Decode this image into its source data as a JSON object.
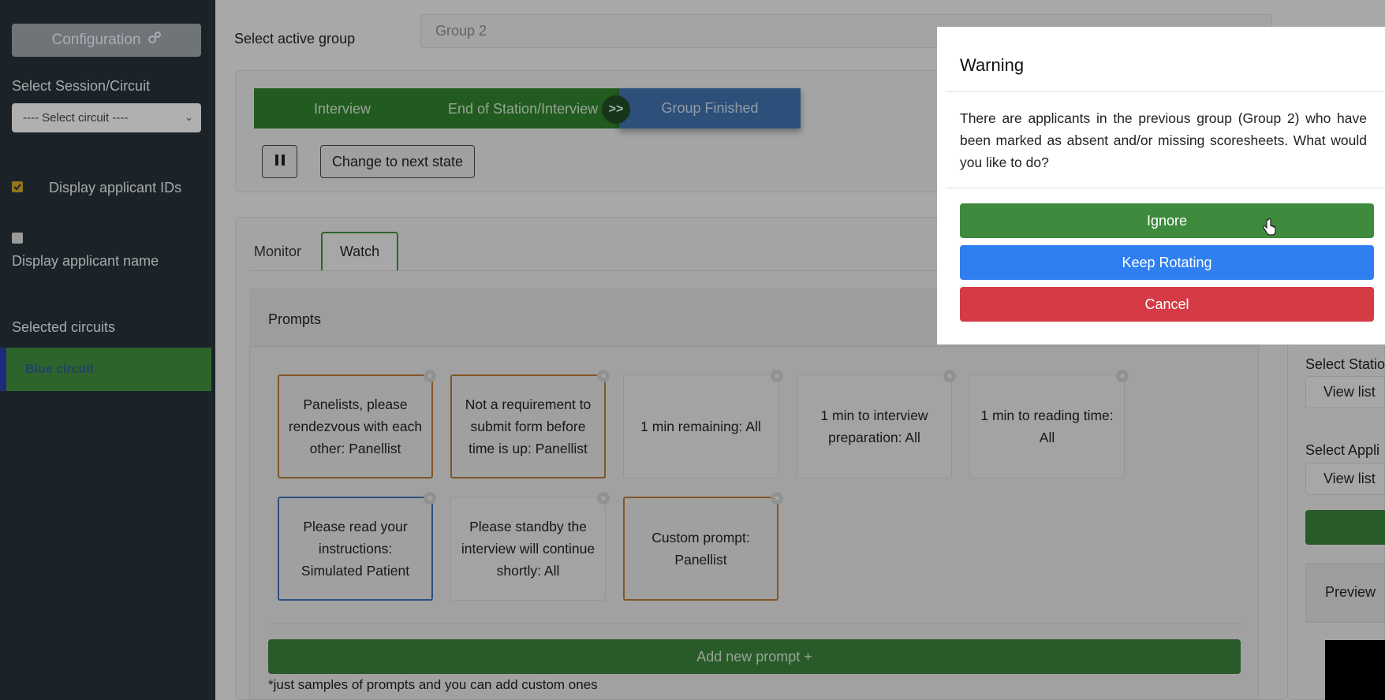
{
  "sidebar": {
    "config_label": "Configuration",
    "session_label": "Select Session/Circuit",
    "circuit_select": "---- Select circuit ----",
    "display_ids_label": "Display applicant IDs",
    "display_name_label": "Display applicant name",
    "selected_circuits_label": "Selected circuits",
    "circuits": [
      "Blue circuit"
    ]
  },
  "header": {
    "group_label": "Select active group",
    "group_value": "Group 2"
  },
  "states": {
    "interview": "Interview",
    "end_station": "End of Station/Interview",
    "arrow": ">>",
    "group_finished": "Group Finished",
    "change_state": "Change to next state"
  },
  "tabs": [
    "Monitor",
    "Watch"
  ],
  "prompts_title": "Prompts",
  "prompts": [
    "Panelists, please rendezvous with each other: Panellist",
    "Not a requirement to submit form before time is up: Panellist",
    "1 min remaining: All",
    "1 min to interview preparation: All",
    "1 min to reading time: All",
    "Please read your instructions: Simulated Patient",
    "Please standby the interview will continue shortly: All",
    "Custom prompt: Panellist"
  ],
  "add_prompt": "Add new prompt +",
  "footnote": "*just samples of prompts and you can add custom ones",
  "right_panel": {
    "select_station": "Select Statio",
    "view_list_1": "View list",
    "select_applicant": "Select Appli",
    "view_list_2": "View list",
    "preview": "Preview"
  },
  "modal": {
    "title": "Warning",
    "body": "There are applicants in the previous group (Group 2) who have been marked as absent and/or missing scoresheets. What would you like to do?",
    "ignore": "Ignore",
    "keep_rotating": "Keep Rotating",
    "cancel": "Cancel"
  },
  "colors": {
    "sidebar": "#263138",
    "ignore": "#3f8b3e",
    "keep_rotating": "#2f7ff0",
    "cancel": "#d43b44",
    "pill_green": "#2f7f2c",
    "pill_blue": "#3e70a8"
  }
}
